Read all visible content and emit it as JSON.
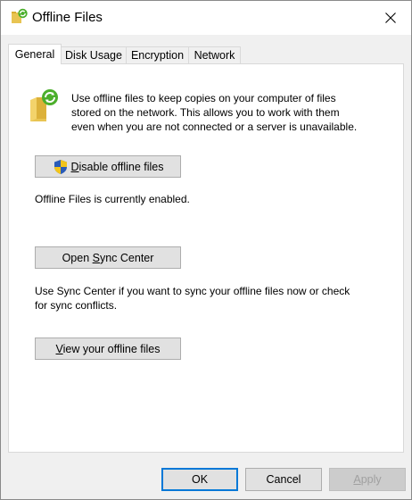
{
  "window": {
    "title": "Offline Files"
  },
  "tabs": [
    {
      "label": "General",
      "active": true
    },
    {
      "label": "Disk Usage",
      "active": false
    },
    {
      "label": "Encryption",
      "active": false
    },
    {
      "label": "Network",
      "active": false
    }
  ],
  "general": {
    "intro_line1": "Use offline files to keep copies on your computer of files",
    "intro_line2": "stored on the network.  This allows you to work with them",
    "intro_line3": "even when you are not connected or a server is unavailable.",
    "disable_button": {
      "mnemonic": "D",
      "rest": "isable offline files"
    },
    "status_text": "Offline Files is currently enabled.",
    "sync_button": {
      "before": "Open ",
      "mnemonic": "S",
      "rest": "ync Center"
    },
    "sync_desc_line1": "Use Sync Center if you want to sync your offline files now or check",
    "sync_desc_line2": "for sync conflicts.",
    "view_button": {
      "mnemonic": "V",
      "rest": "iew your offline files"
    }
  },
  "footer": {
    "ok": "OK",
    "cancel": "Cancel",
    "apply": {
      "mnemonic": "A",
      "rest": "pply"
    }
  },
  "icons": {
    "title": "offline-files-icon",
    "close": "close-icon",
    "intro": "offline-folder-sync-icon",
    "shield": "uac-shield-icon"
  },
  "colors": {
    "accent": "#0078d7",
    "window_bg": "#f0f0f0",
    "button_bg": "#e1e1e1"
  }
}
